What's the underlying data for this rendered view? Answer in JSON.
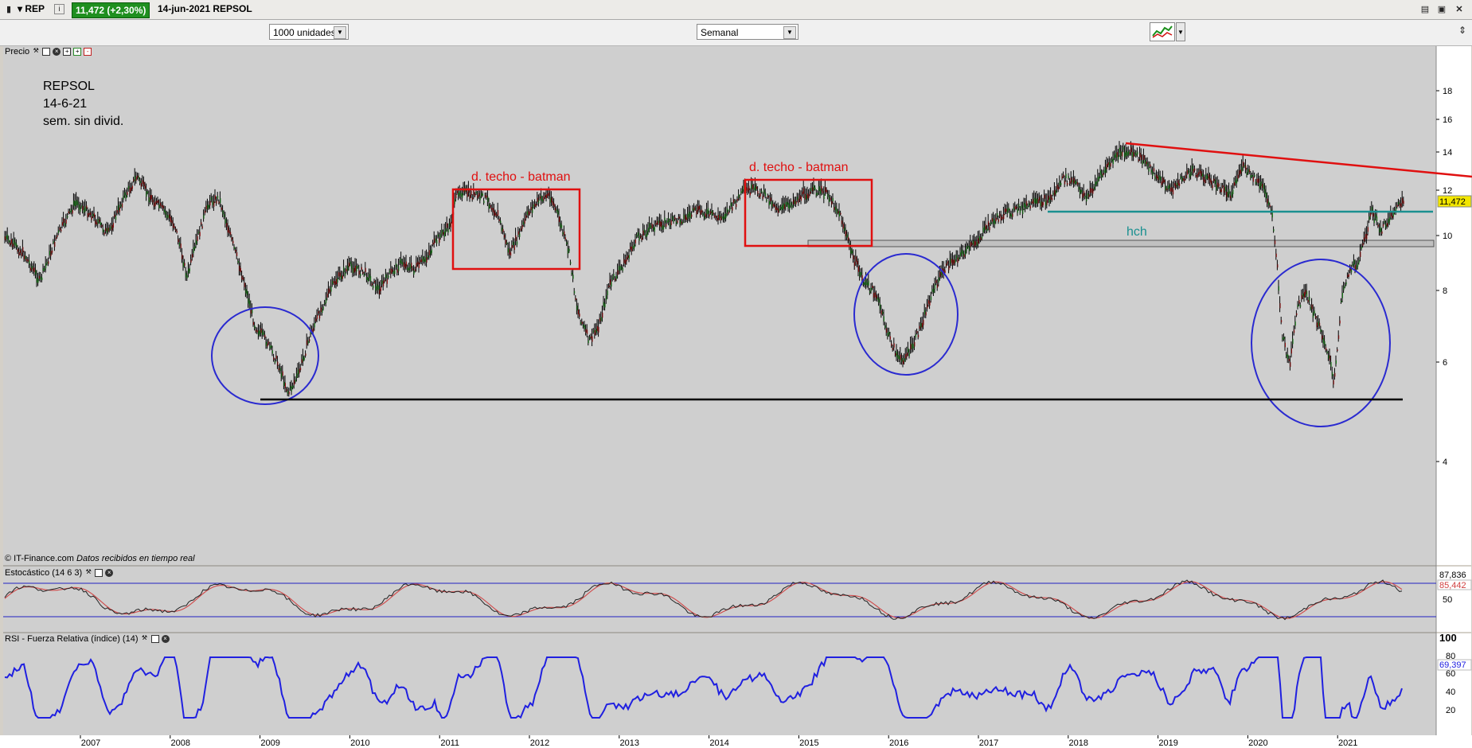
{
  "titlebar": {
    "symbol": "REP",
    "info_icon": "i",
    "price_badge": "11,472 (+2,30%)",
    "date_name": "14-jun-2021 REPSOL",
    "icons": [
      "restore-icon",
      "close-icon",
      "maximize-icon"
    ]
  },
  "toolbar": {
    "units_select": "1000 unidades",
    "period_select": "Semanal",
    "chart_type_icon": "chart-type-icon"
  },
  "price_panel": {
    "label": "Precio",
    "note_lines": [
      "REPSOL",
      "14-6-21",
      "sem. sin divid."
    ],
    "annotation_1": "d. techo - batman",
    "annotation_2": "d. techo - batman",
    "annotation_hch": "hch",
    "credit": "© IT-Finance.com",
    "credit_italic": "Datos recibidos en tiempo real",
    "last_price_label": "11,472",
    "y_ticks": [
      "18",
      "16",
      "14",
      "12",
      "10",
      "8",
      "6",
      "4"
    ]
  },
  "stoch_panel": {
    "label": "Estocástico (14 6 3)",
    "value_1": "87,836",
    "value_2": "85,442",
    "tick": "50"
  },
  "rsi_panel": {
    "label": "RSI - Fuerza Relativa (índice) (14)",
    "top_tick": "100",
    "value": "69,397",
    "ticks": [
      "80",
      "60",
      "40",
      "20"
    ]
  },
  "x_axis": {
    "years": [
      "2007",
      "2008",
      "2009",
      "2010",
      "2011",
      "2012",
      "2013",
      "2014",
      "2015",
      "2016",
      "2017",
      "2018",
      "2019",
      "2020",
      "2021"
    ]
  },
  "colors": {
    "chart_bg": "#cfcfcf",
    "price_bars": "#000000",
    "rectangle": "#e01010",
    "circle": "#2a2ad0",
    "neckline": "#1a9090",
    "rsi_line": "#2020e0",
    "stoch_line": "#7a1a1a",
    "resistance": "#e01010",
    "support": "#000000"
  }
}
